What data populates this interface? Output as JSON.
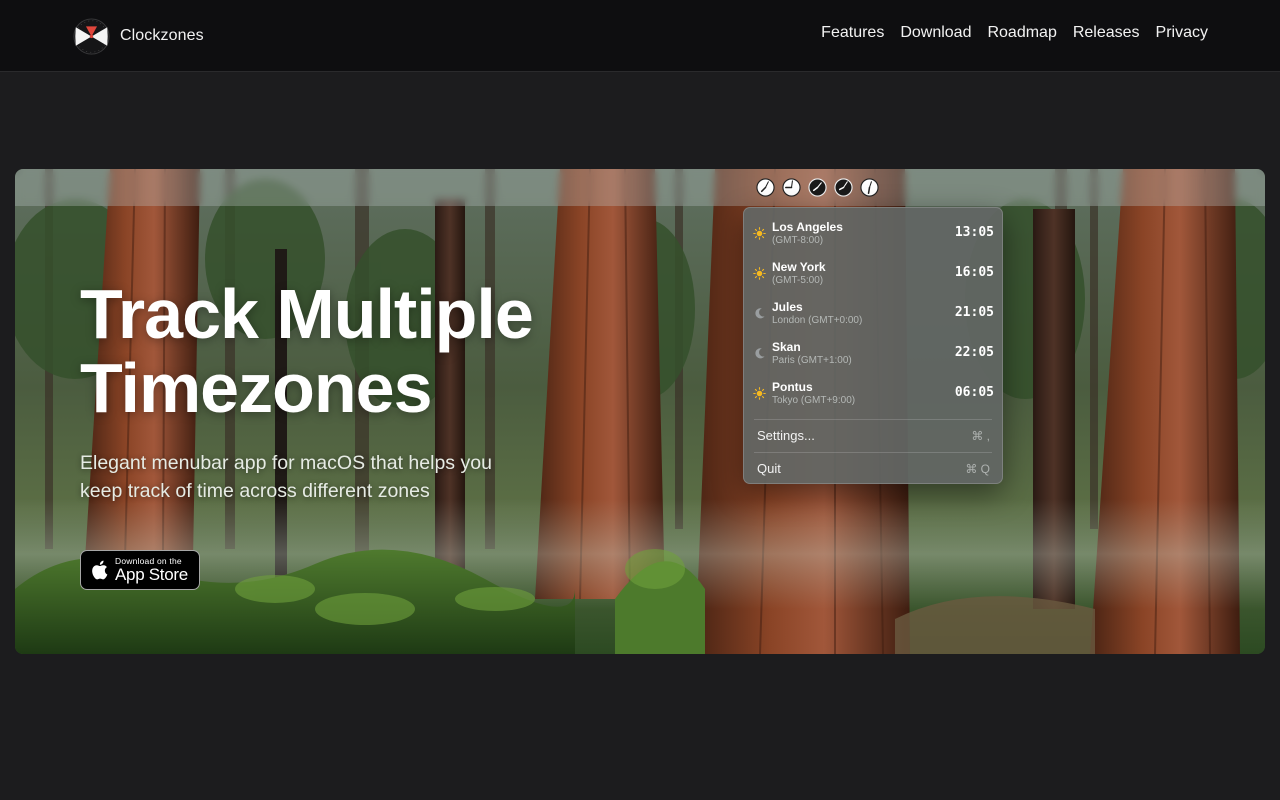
{
  "header": {
    "brand_name": "Clockzones",
    "nav": [
      {
        "label": "Features"
      },
      {
        "label": "Download"
      },
      {
        "label": "Roadmap"
      },
      {
        "label": "Releases"
      },
      {
        "label": "Privacy"
      }
    ]
  },
  "hero": {
    "title": "Track Multiple Timezones",
    "subtitle": "Elegant menubar app for macOS that helps you keep track of time across different zones",
    "badge": {
      "small_text": "Download on the",
      "large_text": "App Store",
      "icon": "apple-icon"
    },
    "menubar_clocks": [
      "clock-icon",
      "clock-icon",
      "clock-icon",
      "clock-icon",
      "clock-icon"
    ]
  },
  "menu": {
    "timezones": [
      {
        "name": "Los Angeles",
        "offset": "(GMT-8:00)",
        "time": "13:05",
        "icon": "sun-icon"
      },
      {
        "name": "New York",
        "offset": "(GMT-5:00)",
        "time": "16:05",
        "icon": "sun-icon"
      },
      {
        "name": "Jules",
        "offset": "London (GMT+0:00)",
        "time": "21:05",
        "icon": "moon-icon"
      },
      {
        "name": "Skan",
        "offset": "Paris (GMT+1:00)",
        "time": "22:05",
        "icon": "moon-icon"
      },
      {
        "name": "Pontus",
        "offset": "Tokyo (GMT+9:00)",
        "time": "06:05",
        "icon": "sun-icon"
      }
    ],
    "settings": {
      "label": "Settings...",
      "shortcut": "⌘ ,"
    },
    "quit": {
      "label": "Quit",
      "shortcut": "⌘ Q"
    }
  },
  "colors": {
    "page_bg": "#1c1c1e",
    "header_bg": "#0e0e10",
    "sun": "#f5b820",
    "moon": "#9a9ea0"
  }
}
